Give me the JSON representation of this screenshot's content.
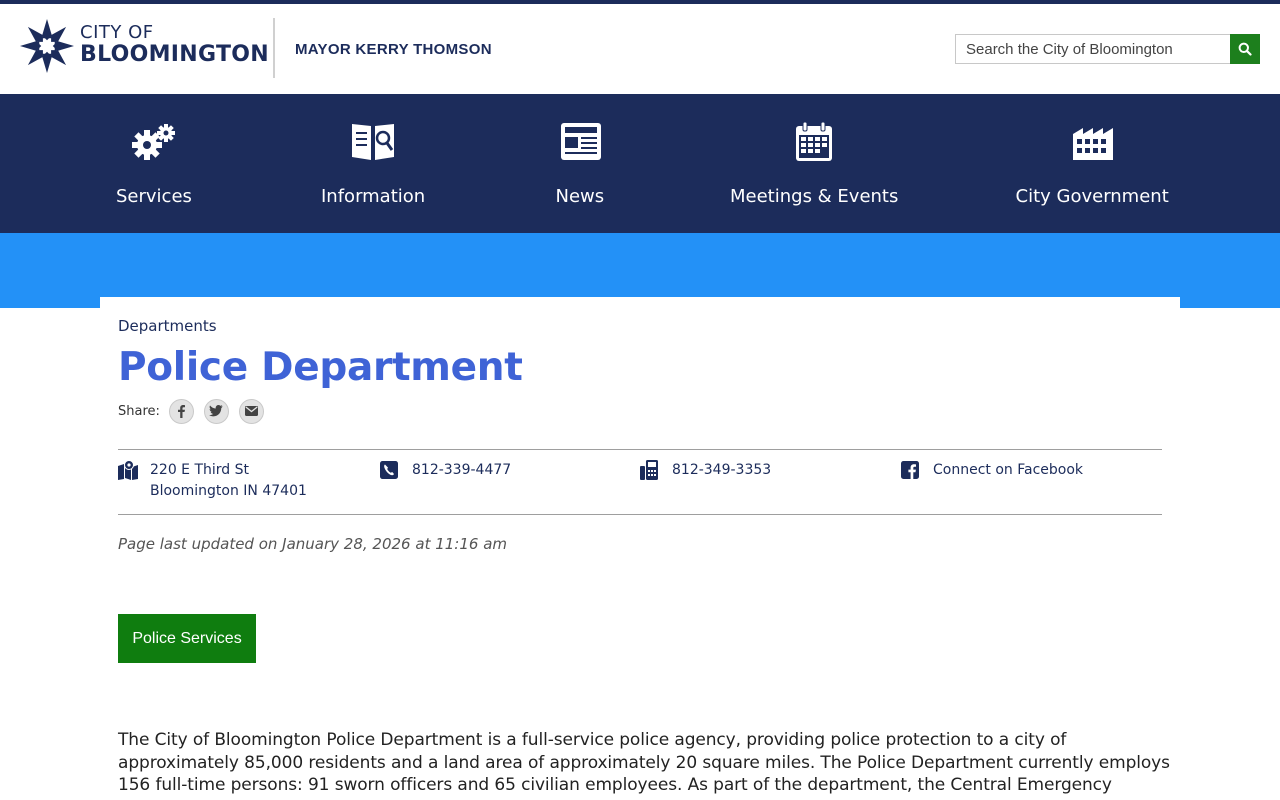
{
  "header": {
    "logo": {
      "line1": "CITY OF",
      "line2": "BLOOMINGTON",
      "icon": "bloomington-star-logo-icon"
    },
    "mayor_link": "MAYOR KERRY THOMSON",
    "search": {
      "placeholder": "Search the City of Bloomington",
      "button_icon": "search-icon"
    }
  },
  "nav": {
    "items": [
      {
        "label": "Services",
        "icon": "gears-icon"
      },
      {
        "label": "Information",
        "icon": "book-search-icon"
      },
      {
        "label": "News",
        "icon": "newspaper-icon"
      },
      {
        "label": "Meetings & Events",
        "icon": "calendar-icon"
      },
      {
        "label": "City Government",
        "icon": "building-icon"
      }
    ]
  },
  "page": {
    "breadcrumb": "Departments",
    "title": "Police Department",
    "share": {
      "label": "Share:",
      "icons": [
        "facebook-icon",
        "twitter-icon",
        "email-icon"
      ]
    },
    "contacts": {
      "address": {
        "line1": "220 E Third St",
        "line2": "Bloomington IN 47401",
        "icon": "map-icon"
      },
      "phone": {
        "value": "812-339-4477",
        "icon": "phone-icon"
      },
      "fax": {
        "value": "812-349-3353",
        "icon": "fax-icon"
      },
      "facebook": {
        "value": "Connect on Facebook",
        "icon": "facebook-square-icon"
      }
    },
    "last_updated": "Page last updated on January 28, 2026 at 11:16 am",
    "services_button": "Police Services",
    "description": "The City of Bloomington Police Department is a full-service police agency, providing police protection to a city of approximately 85,000 residents and a land area of approximately 20 square miles. The Police Department currently employs 156 full-time persons: 91 sworn officers and 65 civilian employees. As part of the department, the Central Emergency Dispatch Center (CEDC),"
  },
  "colors": {
    "navy": "#1c2c5b",
    "hero_blue": "#2391f7",
    "title_blue": "#3f63d6",
    "green": "#0f7d0f"
  }
}
